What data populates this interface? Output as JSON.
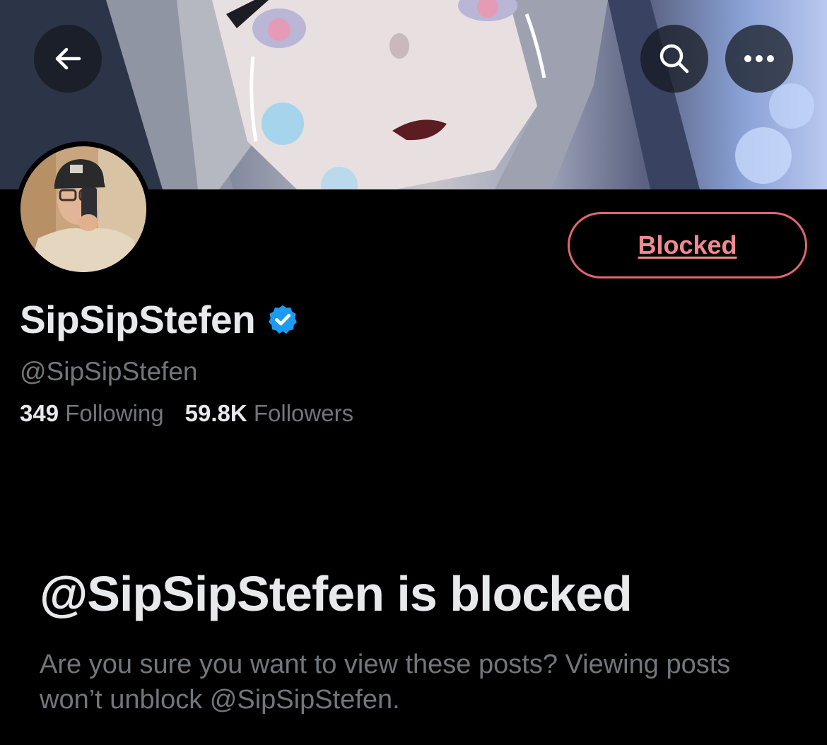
{
  "header": {
    "back_icon": "arrow-left-icon",
    "search_icon": "search-icon",
    "more_icon": "more-horizontal-icon"
  },
  "profile": {
    "display_name": "SipSipStefen",
    "handle": "@SipSipStefen",
    "verified_icon": "verified-badge-icon",
    "verified_color": "#1d9bf0",
    "following_count": "349",
    "following_label": "Following",
    "followers_count": "59.8K",
    "followers_label": "Followers"
  },
  "action": {
    "blocked_label": "Blocked",
    "blocked_color": "#f4212e"
  },
  "blocked_notice": {
    "title": "@SipSipStefen is blocked",
    "description": "Are you sure you want to view these posts? Viewing posts won’t unblock @SipSipStefen."
  }
}
